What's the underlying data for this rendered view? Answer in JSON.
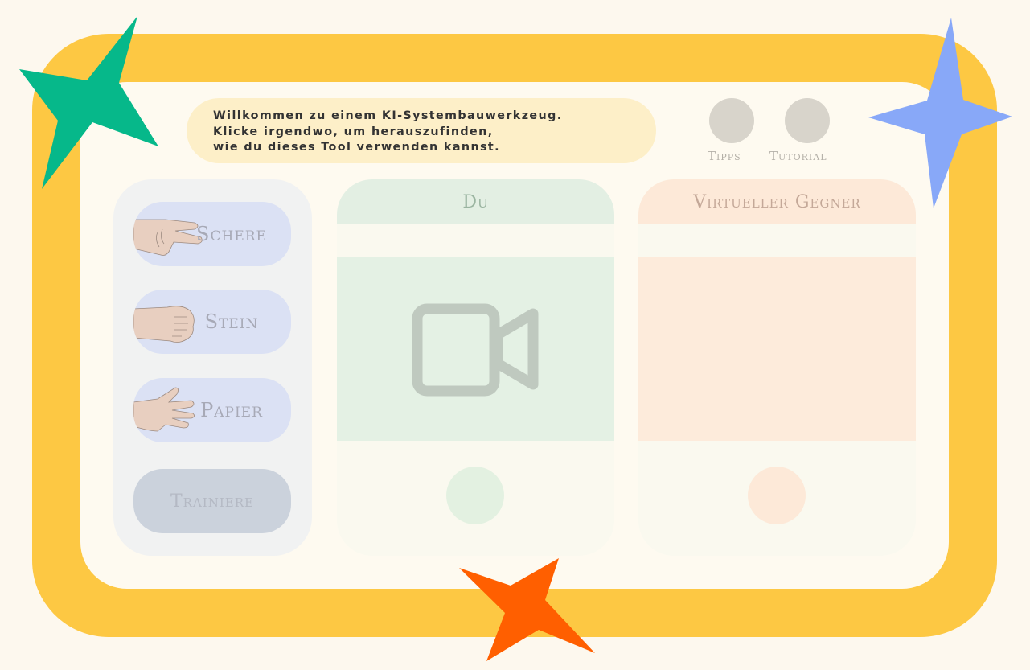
{
  "welcome": {
    "line1": "Willkommen zu einem KI-Systembauwerkzeug.",
    "line2": "Klicke irgendwo, um herauszufinden,",
    "line3": "wie du dieses Tool verwenden kannst."
  },
  "top_buttons": {
    "tips_label": "Tipps",
    "tutorial_label": "Tutorial"
  },
  "gestures": [
    {
      "label": "Schere",
      "icon": "scissors-hand-icon"
    },
    {
      "label": "Stein",
      "icon": "fist-hand-icon"
    },
    {
      "label": "Papier",
      "icon": "open-hand-icon"
    }
  ],
  "train_label": "Trainiere",
  "you_panel": {
    "title": "Du",
    "icon": "video-camera-icon"
  },
  "opponent_panel": {
    "title": "Virtueller Gegner"
  },
  "colors": {
    "frame": "#fdc843",
    "star_green": "#06b88a",
    "star_blue": "#88a8f8",
    "star_orange": "#ff5f00"
  }
}
